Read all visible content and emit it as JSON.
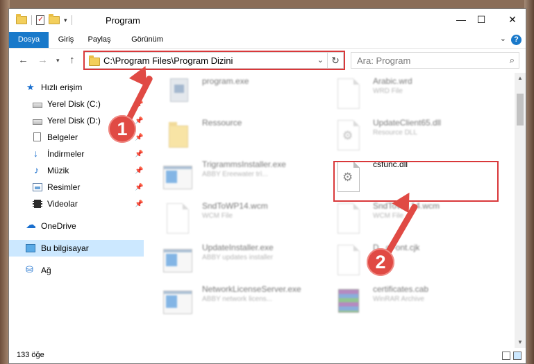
{
  "window": {
    "title": "Program",
    "minimize": "—",
    "maximize": "☐",
    "close": "✕"
  },
  "ribbon": {
    "tabs": [
      "Dosya",
      "Giriş",
      "Paylaş",
      "Görünüm"
    ],
    "help": "?"
  },
  "address": {
    "path": "C:\\Program Files\\Program Dizini",
    "search_placeholder": "Ara: Program"
  },
  "sidebar": {
    "items": [
      {
        "label": "Hızlı erişim",
        "icon": "star-icon"
      },
      {
        "label": "Yerel Disk (C:)",
        "icon": "drive-icon",
        "pinned": true
      },
      {
        "label": "Yerel Disk (D:)",
        "icon": "drive-icon",
        "pinned": true
      },
      {
        "label": "Belgeler",
        "icon": "documents-icon",
        "pinned": true
      },
      {
        "label": "İndirmeler",
        "icon": "downloads-icon",
        "pinned": true
      },
      {
        "label": "Müzik",
        "icon": "music-icon",
        "pinned": true
      },
      {
        "label": "Resimler",
        "icon": "pictures-icon",
        "pinned": true
      },
      {
        "label": "Videolar",
        "icon": "videos-icon",
        "pinned": true
      },
      {
        "label": "OneDrive",
        "icon": "cloud-icon"
      },
      {
        "label": "Bu bilgisayar",
        "icon": "computer-icon",
        "selected": true
      },
      {
        "label": "Ağ",
        "icon": "network-icon"
      }
    ]
  },
  "files": [
    {
      "name": "program.exe",
      "type": ""
    },
    {
      "name": "Arabic.wrd",
      "type": "WRD File"
    },
    {
      "name": "Ressource",
      "type": ""
    },
    {
      "name": "UpdateClient65.dll",
      "type": "Resource DLL"
    },
    {
      "name": "TrigrammsInstaller.exe",
      "type": "ABBY Ereewater trì..."
    },
    {
      "name": "csfunc.dll",
      "type": ""
    },
    {
      "name": "SndToWP14.wcm",
      "type": "WCM File"
    },
    {
      "name": "SndToW...14.wcm",
      "type": "WCM File"
    },
    {
      "name": "UpdateInstaller.exe",
      "type": "ABBY updates installer"
    },
    {
      "name": "D...dFont.cjk",
      "type": ""
    },
    {
      "name": "NetworkLicenseServer.exe",
      "type": "ABBY network licens..."
    },
    {
      "name": "certificates.cab",
      "type": "WinRAR Archive"
    }
  ],
  "status": {
    "item_count": "133 öğe"
  },
  "callouts": {
    "one": "1",
    "two": "2"
  },
  "colors": {
    "accent": "#1979ca",
    "highlight": "#d9383a",
    "callout": "#e04a44",
    "selection": "#cce8ff"
  }
}
